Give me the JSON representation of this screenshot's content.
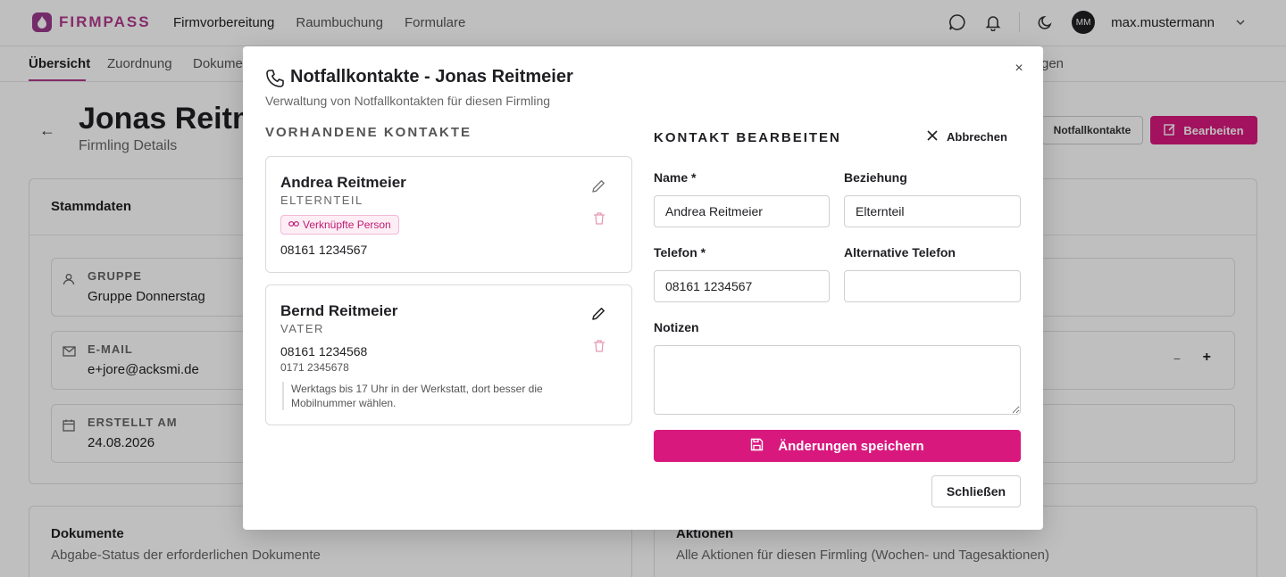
{
  "app": {
    "brand": "FIRMPASS",
    "brand_logo_icon": "flame-icon"
  },
  "topnav": {
    "items": [
      "Firmvorbereitung",
      "Raumbuchung",
      "Formulare"
    ],
    "active": "Firmvorbereitung"
  },
  "user": {
    "initials": "MM",
    "name": "max.mustermann"
  },
  "subnav": {
    "items": [
      "Übersicht",
      "Zuordnung",
      "Dokume",
      "gen"
    ]
  },
  "page": {
    "title": "Jonas Reitm",
    "subtitle": "Firmling Details",
    "btn_notfall": "Notfallkontakte",
    "btn_edit": "Bearbeiten"
  },
  "stammdaten": {
    "title": "Stammdaten",
    "fields": [
      {
        "label": "GRUPPE",
        "value": "Gruppe Donnerstag",
        "icon": "user-icon"
      },
      {
        "label": "E-MAIL",
        "value": "e+jore@acksmi.de",
        "icon": "mail-icon"
      },
      {
        "label": "ERSTELLT AM",
        "value": "24.08.2026",
        "icon": "calendar-icon"
      }
    ],
    "stepper_minus": "−",
    "stepper_plus": "+"
  },
  "dokumente": {
    "title": "Dokumente",
    "subtitle": "Abgabe-Status der erforderlichen Dokumente"
  },
  "aktionen": {
    "title": "Aktionen",
    "subtitle": "Alle Aktionen für diesen Firmling (Wochen- und Tagesaktionen)"
  },
  "modal": {
    "title": "Notfallkontakte - Jonas Reitmeier",
    "description": "Verwaltung von Notfallkontakten für diesen Firmling",
    "close_glyph": "×",
    "existing_heading": "VORHANDENE KONTAKTE",
    "contacts": [
      {
        "name": "Andrea Reitmeier",
        "relation": "ELTERNTEIL",
        "badge": "Verknüpfte Person",
        "phone": "08161 1234567"
      },
      {
        "name": "Bernd Reitmeier",
        "relation": "VATER",
        "phone": "08161 1234568",
        "phone_alt": "0171 2345678",
        "note": "Werktags bis 17 Uhr in der Werkstatt, dort besser die Mobilnummer wählen."
      }
    ],
    "edit": {
      "heading": "KONTAKT BEARBEITEN",
      "cancel": "Abbrechen",
      "name_label": "Name *",
      "name_value": "Andrea Reitmeier",
      "relation_label": "Beziehung",
      "relation_value": "Elternteil",
      "phone_label": "Telefon *",
      "phone_value": "08161 1234567",
      "alt_phone_label": "Alternative Telefon",
      "alt_phone_value": "",
      "notes_label": "Notizen",
      "notes_value": "",
      "save": "Änderungen speichern"
    },
    "close_button": "Schließen"
  },
  "colors": {
    "accent": "#d9187e",
    "brand": "#b23a8e",
    "badge_bg": "#fdeef6"
  }
}
